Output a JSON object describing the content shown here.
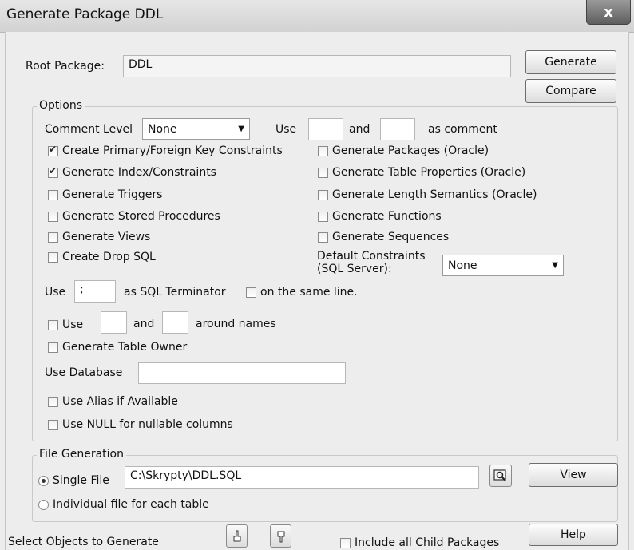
{
  "window": {
    "title": "Generate Package DDL",
    "close_label": "x"
  },
  "root": {
    "label": "Root Package:",
    "value": "DDL"
  },
  "buttons": {
    "generate": "Generate",
    "compare": "Compare",
    "view": "View",
    "help": "Help"
  },
  "options": {
    "title": "Options",
    "comment_level_label": "Comment Level",
    "comment_level_value": "None",
    "use_label": "Use",
    "and_label": "and",
    "as_comment_label": "as comment",
    "left_checks": [
      {
        "label": "Create Primary/Foreign Key Constraints",
        "checked": true
      },
      {
        "label": "Generate Index/Constraints",
        "checked": true
      },
      {
        "label": "Generate Triggers",
        "checked": false
      },
      {
        "label": "Generate Stored Procedures",
        "checked": false
      },
      {
        "label": "Generate Views",
        "checked": false
      },
      {
        "label": "Create Drop SQL",
        "checked": false
      }
    ],
    "right_checks": [
      {
        "label": "Generate Packages (Oracle)",
        "checked": false
      },
      {
        "label": "Generate Table Properties (Oracle)",
        "checked": false
      },
      {
        "label": "Generate Length Semantics (Oracle)",
        "checked": false
      },
      {
        "label": "Generate Functions",
        "checked": false
      },
      {
        "label": "Generate Sequences",
        "checked": false
      }
    ],
    "default_constraints_line1": "Default Constraints",
    "default_constraints_line2": "(SQL Server):",
    "default_constraints_value": "None",
    "terminator_use_label": "Use",
    "terminator_value": ";",
    "terminator_label": "as SQL Terminator",
    "same_line_label": "on the same line.",
    "names_use_label": "Use",
    "names_and_label": "and",
    "around_names_label": "around names",
    "table_owner_label": "Generate Table Owner",
    "use_database_label": "Use Database",
    "use_database_value": "",
    "use_alias_label": "Use Alias if Available",
    "use_null_label": "Use NULL for nullable columns"
  },
  "file_generation": {
    "title": "File Generation",
    "single_file_label": "Single File",
    "single_file_selected": true,
    "path": "C:\\Skrypty\\DDL.SQL",
    "individual_label": "Individual file for each table"
  },
  "bottom": {
    "select_objects_label": "Select Objects to Generate",
    "include_children_label": "Include all Child Packages"
  },
  "icons": {
    "browse": "folder-search-icon",
    "move_up": "hand-up-icon",
    "move_down": "hand-down-icon"
  }
}
